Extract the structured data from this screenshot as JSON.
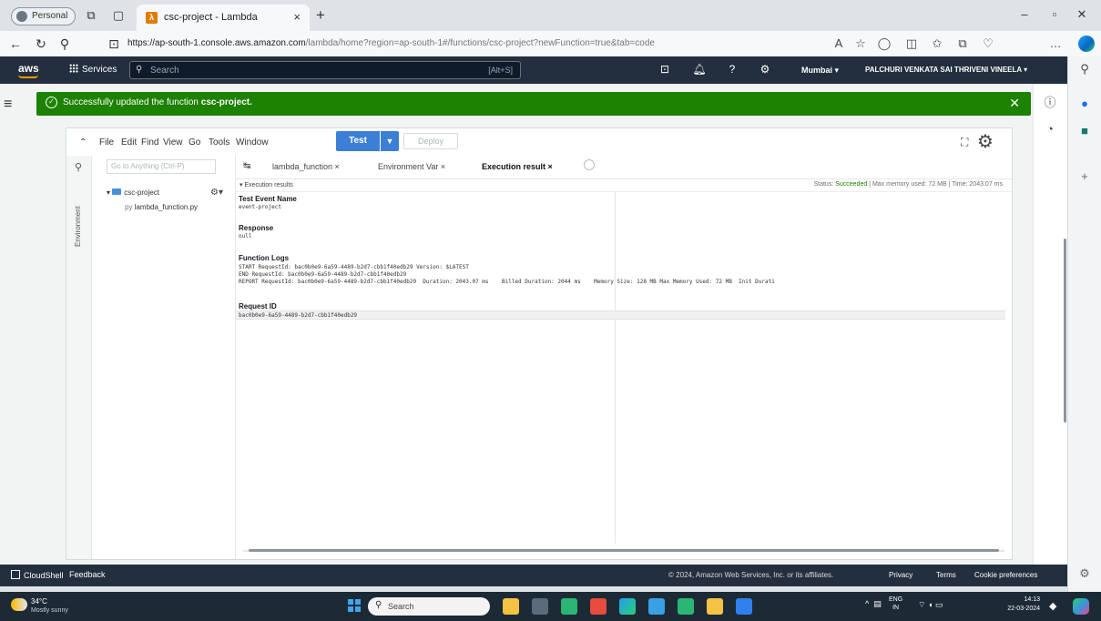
{
  "browser": {
    "profile_label": "Personal",
    "tab_title": "csc-project - Lambda",
    "tab_favicon_text": "λ",
    "url_host": "https://ap-south-1.console.aws.amazon.com",
    "url_path": "/lambda/home?region=ap-south-1#/functions/csc-project?newFunction=true&tab=code"
  },
  "aws_nav": {
    "logo": "aws",
    "services_label": "Services",
    "search_placeholder": "Search",
    "search_shortcut": "[Alt+S]",
    "region": "Mumbai ▾",
    "account": "PALCHURI VENKATA SAI THRIVENI VINEELA ▾"
  },
  "flash": {
    "message_prefix": "Successfully updated the function ",
    "function_name": "csc-project."
  },
  "ide": {
    "menu": [
      "File",
      "Edit",
      "Find",
      "View",
      "Go",
      "Tools",
      "Window"
    ],
    "test_label": "Test",
    "deploy_label": "Deploy",
    "goto_placeholder": "Go to Anything (Ctrl-P)",
    "env_label": "Environment",
    "tree": {
      "folder": "csc-project",
      "file": "lambda_function.py"
    },
    "tabs": [
      "lambda_function ×",
      "Environment Var ×",
      "Execution result ×"
    ]
  },
  "results": {
    "header_title": "▾ Execution results",
    "status_line": "Status: Succeeded | Max memory used: 72 MB | Time: 2043.07 ms",
    "status_label": "Status:",
    "status_value": "Succeeded",
    "test_event_title": "Test Event Name",
    "test_event_value": "event-project",
    "response_title": "Response",
    "response_value": "null",
    "logs_title": "Function Logs",
    "log_lines": [
      "START RequestId: bac0b0e9-6a59-4489-b2d7-cbb1f40edb29 Version: $LATEST",
      "END RequestId: bac0b0e9-6a59-4489-b2d7-cbb1f40edb29",
      "REPORT RequestId: bac0b0e9-6a59-4489-b2d7-cbb1f40edb29  Duration: 2043.07 ms    Billed Duration: 2044 ms    Memory Size: 128 MB Max Memory Used: 72 MB  Init Durati"
    ],
    "request_id_title": "Request ID",
    "request_id_value": "bac0b0e9-6a59-4489-b2d7-cbb1f40edb29"
  },
  "footer": {
    "cloudshell": "CloudShell",
    "feedback": "Feedback",
    "copyright": "© 2024, Amazon Web Services, Inc. or its affiliates.",
    "privacy": "Privacy",
    "terms": "Terms",
    "cookies": "Cookie preferences"
  },
  "taskbar": {
    "temp": "34°C",
    "weather": "Mostly sunny",
    "search": "Search",
    "lang_top": "ENG",
    "lang_bottom": "IN",
    "time": "14:13",
    "date": "22-03-2024"
  },
  "colors": {
    "aws_nav": "#232f3e",
    "success": "#1d8102",
    "primary_button": "#3b7fd6",
    "accent": "#ff9900"
  }
}
